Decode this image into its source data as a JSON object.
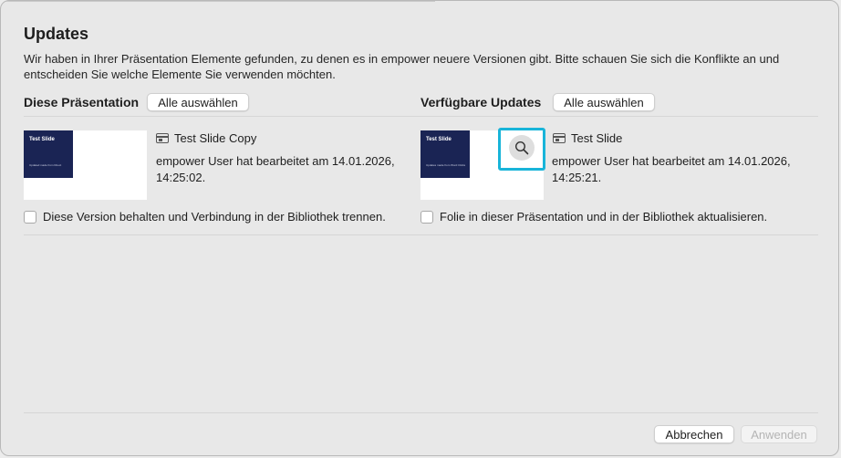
{
  "dialog": {
    "title": "Updates",
    "intro": "Wir haben in Ihrer Präsentation Elemente gefunden, zu denen es in empower neuere Versionen gibt. Bitte schauen Sie sich die Konflikte an und entscheiden Sie welche Elemente Sie verwenden möchten."
  },
  "left": {
    "heading": "Diese Präsentation",
    "select_all": "Alle auswählen",
    "thumb_title": "Test Slide",
    "thumb_subtitle": "Updated made from Direct",
    "slide_name": "Test Slide Copy",
    "meta": "empower User hat bearbeitet am 14.01.2026, 14:25:02.",
    "checkbox_label": "Diese Version behalten und Verbindung in der Bibliothek trennen.",
    "checked": false
  },
  "right": {
    "heading": "Verfügbare Updates",
    "select_all": "Alle auswählen",
    "thumb_title": "Test Slide",
    "thumb_subtitle": "Updates made from Word Clicks",
    "slide_name": "Test Slide",
    "meta": "empower User hat bearbeitet am 14.01.2026, 14:25:21.",
    "checkbox_label": "Folie in dieser Präsentation und in der Bibliothek aktualisieren.",
    "checked": false,
    "preview_icon": "magnifier-icon"
  },
  "footer": {
    "cancel": "Abbrechen",
    "apply": "Anwenden"
  },
  "colors": {
    "highlight": "#18b4d9",
    "slide_navy": "#1a2454"
  }
}
